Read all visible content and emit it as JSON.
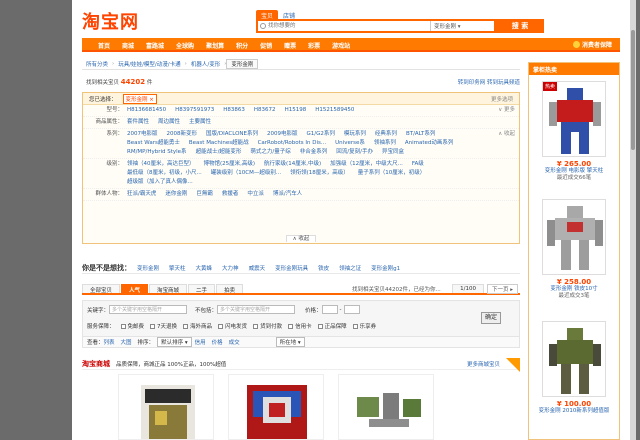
{
  "header": {
    "logo": "淘宝网",
    "search_tabs": [
      "宝贝",
      "店铺"
    ],
    "search_placeholder": "找你想要的",
    "search_category": "变形金刚",
    "search_button": "搜 索"
  },
  "nav": {
    "items": [
      "首页",
      "商城",
      "富路城",
      "全球购",
      "聚划算",
      "积分",
      "促销",
      "赠票",
      "彩票",
      "游戏站"
    ],
    "club": "消费者保障"
  },
  "breadcrumb": [
    "所有分类",
    "玩具/娃娃/模型/动漫/卡通",
    "机器人/变形",
    "变形金刚"
  ],
  "found": {
    "prefix": "找到相关宝贝",
    "count": "44202",
    "suffix": "件",
    "links": "转到印务网  转到玩具频道"
  },
  "filter": {
    "selected_label": "您已选择：",
    "selected_tag": "变形金刚 ×",
    "more": "更多选项",
    "rows": [
      {
        "label": "型号：",
        "values": [
          "H8136681450",
          "H8397591973",
          "H83863",
          "H83672",
          "H15198",
          "H1521589450"
        ],
        "ctl": "∨ 更多"
      },
      {
        "label": "商品属性：",
        "values": [
          "套件属性",
          "周边属性",
          "主要属性"
        ],
        "ctl": ""
      },
      {
        "label": "系列：",
        "values": [
          "2007电影版",
          "2008新变形",
          "国版/DIACLONE系列",
          "2009电影版",
          "G1/G2系列",
          "模玩系列",
          "经典系列",
          "BT/ALT系列",
          "Beast Wars超能勇士",
          "Beast Machines超能战",
          "CarRobot/Robots In Dis...",
          "Universe系",
          "领袖系列",
          "Animated动画系列",
          "RM/MP/Hybrid Style系",
          "超能战士/超能变形",
          "萌式之力/量子综",
          "非合金系列",
          "回流/复刻/手办",
          "异宝同盒"
        ],
        "ctl": "∧ 收起"
      },
      {
        "label": "级别：",
        "values": [
          "领袖（40厘米，高达巨型）",
          "博物馆(25厘米,高级)",
          "航行家级(14厘米,中级)",
          "加强级（12厘米，中级大尺...",
          "FA级",
          "最低级（8厘米，初级，小尺...",
          "罐装级别（10CM—超级别...",
          "领衔领(18厘米，高级）",
          "量子系列（10厘米，初级）",
          "超级版（加入了真人偶像..."
        ],
        "ctl": ""
      },
      {
        "label": "群体人物：",
        "values": [
          "狂派/霸天虎",
          "迷你金刚",
          "巨無霸",
          "救援者",
          "中立派",
          "博派/汽车人"
        ],
        "ctl": ""
      }
    ],
    "fold": "∧ 收起"
  },
  "related": {
    "title": "你是不是想找：",
    "items": [
      "变形金刚",
      "擎天柱",
      "大黄蜂",
      "大力神",
      "威震天",
      "变形金刚玩具",
      "铁皮",
      "领袖之证",
      "变形金刚g1"
    ]
  },
  "result_tabs": [
    "全部宝贝",
    "人气",
    "淘宝商城",
    "二手",
    "拍卖"
  ],
  "notice": "找到相关宝贝44202件，已经为你...",
  "pager": {
    "text": "1/100",
    "next": "下一页 ▸"
  },
  "search_bar": {
    "keyword_label": "关键字：",
    "keyword_placeholder": "多个关键字用空格隔开",
    "exclude_label": "不包括：",
    "exclude_placeholder": "多个关键字用空格隔开",
    "price_label": "价格：",
    "price_sep": "-",
    "service_label": "服务保障：",
    "options": [
      "免邮费",
      "7天退换",
      "海外商品",
      "闪电发货",
      "货到付款",
      "信用卡",
      "正品保障",
      "乐享券"
    ],
    "ok": "确定"
  },
  "view_bar": {
    "label": "查看：",
    "modes": [
      "列表",
      "大图"
    ],
    "sort_label": "排序：",
    "sort_value": "默认排序",
    "filters": [
      "信用",
      "价格",
      "成交"
    ],
    "location": "所在地"
  },
  "mall_bar": {
    "title": "淘宝商城",
    "text": "品质保障，商城正品 100%正品，100%超值",
    "more": "更多商城宝贝"
  },
  "sidebar": {
    "title": "掌柜热卖",
    "items": [
      {
        "badge": "热卖",
        "price": "¥ 265.00",
        "name": "变形金刚 电影版 擎天柱",
        "sold": "最近成交66笔"
      },
      {
        "badge": "",
        "price": "¥ 258.00",
        "name": "变形金刚 铁皮10寸",
        "sold": "最近成交3笔"
      },
      {
        "badge": "",
        "price": "¥ 100.00",
        "name": "变形金刚 2010新系列超值版",
        "sold": ""
      }
    ]
  }
}
